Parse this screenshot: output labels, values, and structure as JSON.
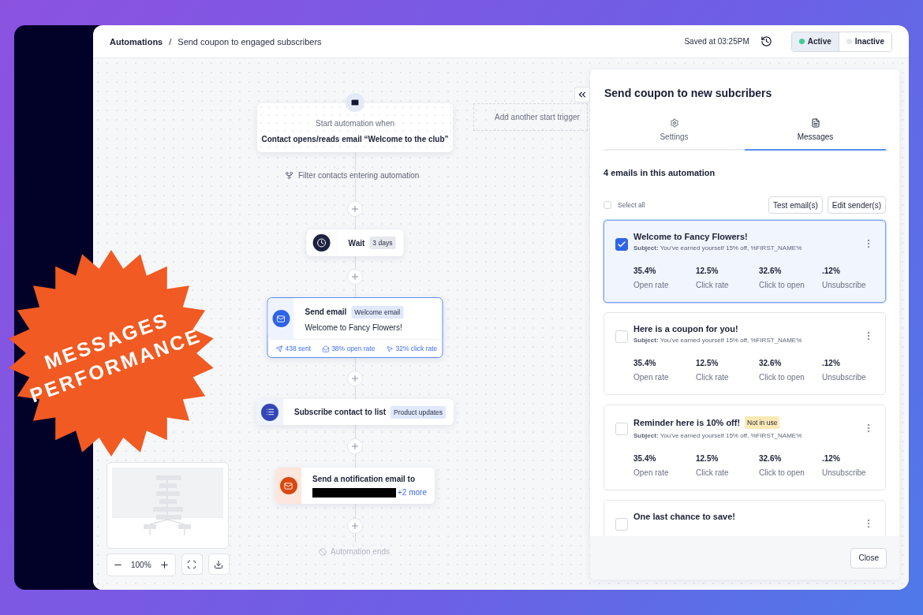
{
  "header": {
    "breadcrumb_root": "Automations",
    "separator": "/",
    "title": "Send coupon to engaged subscribers",
    "saved": "Saved at 03:25PM",
    "status_options": [
      {
        "label": "Active",
        "selected": true,
        "color": "#3ccf91"
      },
      {
        "label": "Inactive",
        "selected": false,
        "color": "#e4e6ea"
      }
    ]
  },
  "badge": {
    "lines": [
      "MESSAGES",
      "PERFORMANCE"
    ]
  },
  "canvas": {
    "trigger": {
      "caption": "Start automation when",
      "text": "Contact opens/reads email “Welcome to the club”"
    },
    "add_trigger": "Add another start trigger",
    "filter": "Filter contacts entering automation",
    "steps": [
      {
        "kind": "wait",
        "title": "Wait",
        "tag": "3 days"
      },
      {
        "kind": "email",
        "title": "Send email",
        "tag": "Welcome email",
        "text": "Welcome to Fancy Flowers!",
        "stats": [
          "438 sent",
          "38% open rate",
          "32% click rate"
        ]
      },
      {
        "kind": "list",
        "title": "Subscribe contact to list",
        "tag": "Product updates"
      },
      {
        "kind": "notify",
        "title": "Send a notification email to",
        "more": "+2 more"
      }
    ],
    "end": "Automation ends",
    "zoom": "100%"
  },
  "panel": {
    "title": "Send coupon to new subcribers",
    "tabs": [
      {
        "label": "Settings",
        "selected": false
      },
      {
        "label": "Messages",
        "selected": true
      }
    ],
    "count": "4 emails in this automation",
    "select_all": {
      "label": "Select all",
      "checked": false
    },
    "actions": [
      "Test email(s)",
      "Edit sender(s)"
    ],
    "messages": [
      {
        "title": "Welcome to Fancy Flowers!",
        "checked": true,
        "subject_label": "Subject:",
        "subject": "You’ve earned yourself 15% off, %FIRST_NAME%",
        "stats": [
          {
            "value": "35.4%",
            "label": "Open rate"
          },
          {
            "value": "12.5%",
            "label": "Click rate"
          },
          {
            "value": "32.6%",
            "label": "Click to open"
          },
          {
            "value": ".12%",
            "label": "Unsubscribe"
          }
        ]
      },
      {
        "title": "Here is a coupon for you!",
        "checked": false,
        "subject_label": "Subject:",
        "subject": "You’ve earned yourself 15% off, %FIRST_NAME%",
        "stats": [
          {
            "value": "35.4%",
            "label": "Open rate"
          },
          {
            "value": "12.5%",
            "label": "Click rate"
          },
          {
            "value": "32.6%",
            "label": "Click to open"
          },
          {
            "value": ".12%",
            "label": "Unsubscribe"
          }
        ]
      },
      {
        "title": "Reminder here is 10% off!",
        "checked": false,
        "tag": "Not in use",
        "subject_label": "Subject:",
        "subject": "You’ve earned yourself 15% off, %FIRST_NAME%",
        "stats": [
          {
            "value": "35.4%",
            "label": "Open rate"
          },
          {
            "value": "12.5%",
            "label": "Click rate"
          },
          {
            "value": "32.6%",
            "label": "Click to open"
          },
          {
            "value": ".12%",
            "label": "Unsubscribe"
          }
        ]
      },
      {
        "title": "One last chance to save!",
        "checked": false
      }
    ],
    "close": "Close"
  }
}
